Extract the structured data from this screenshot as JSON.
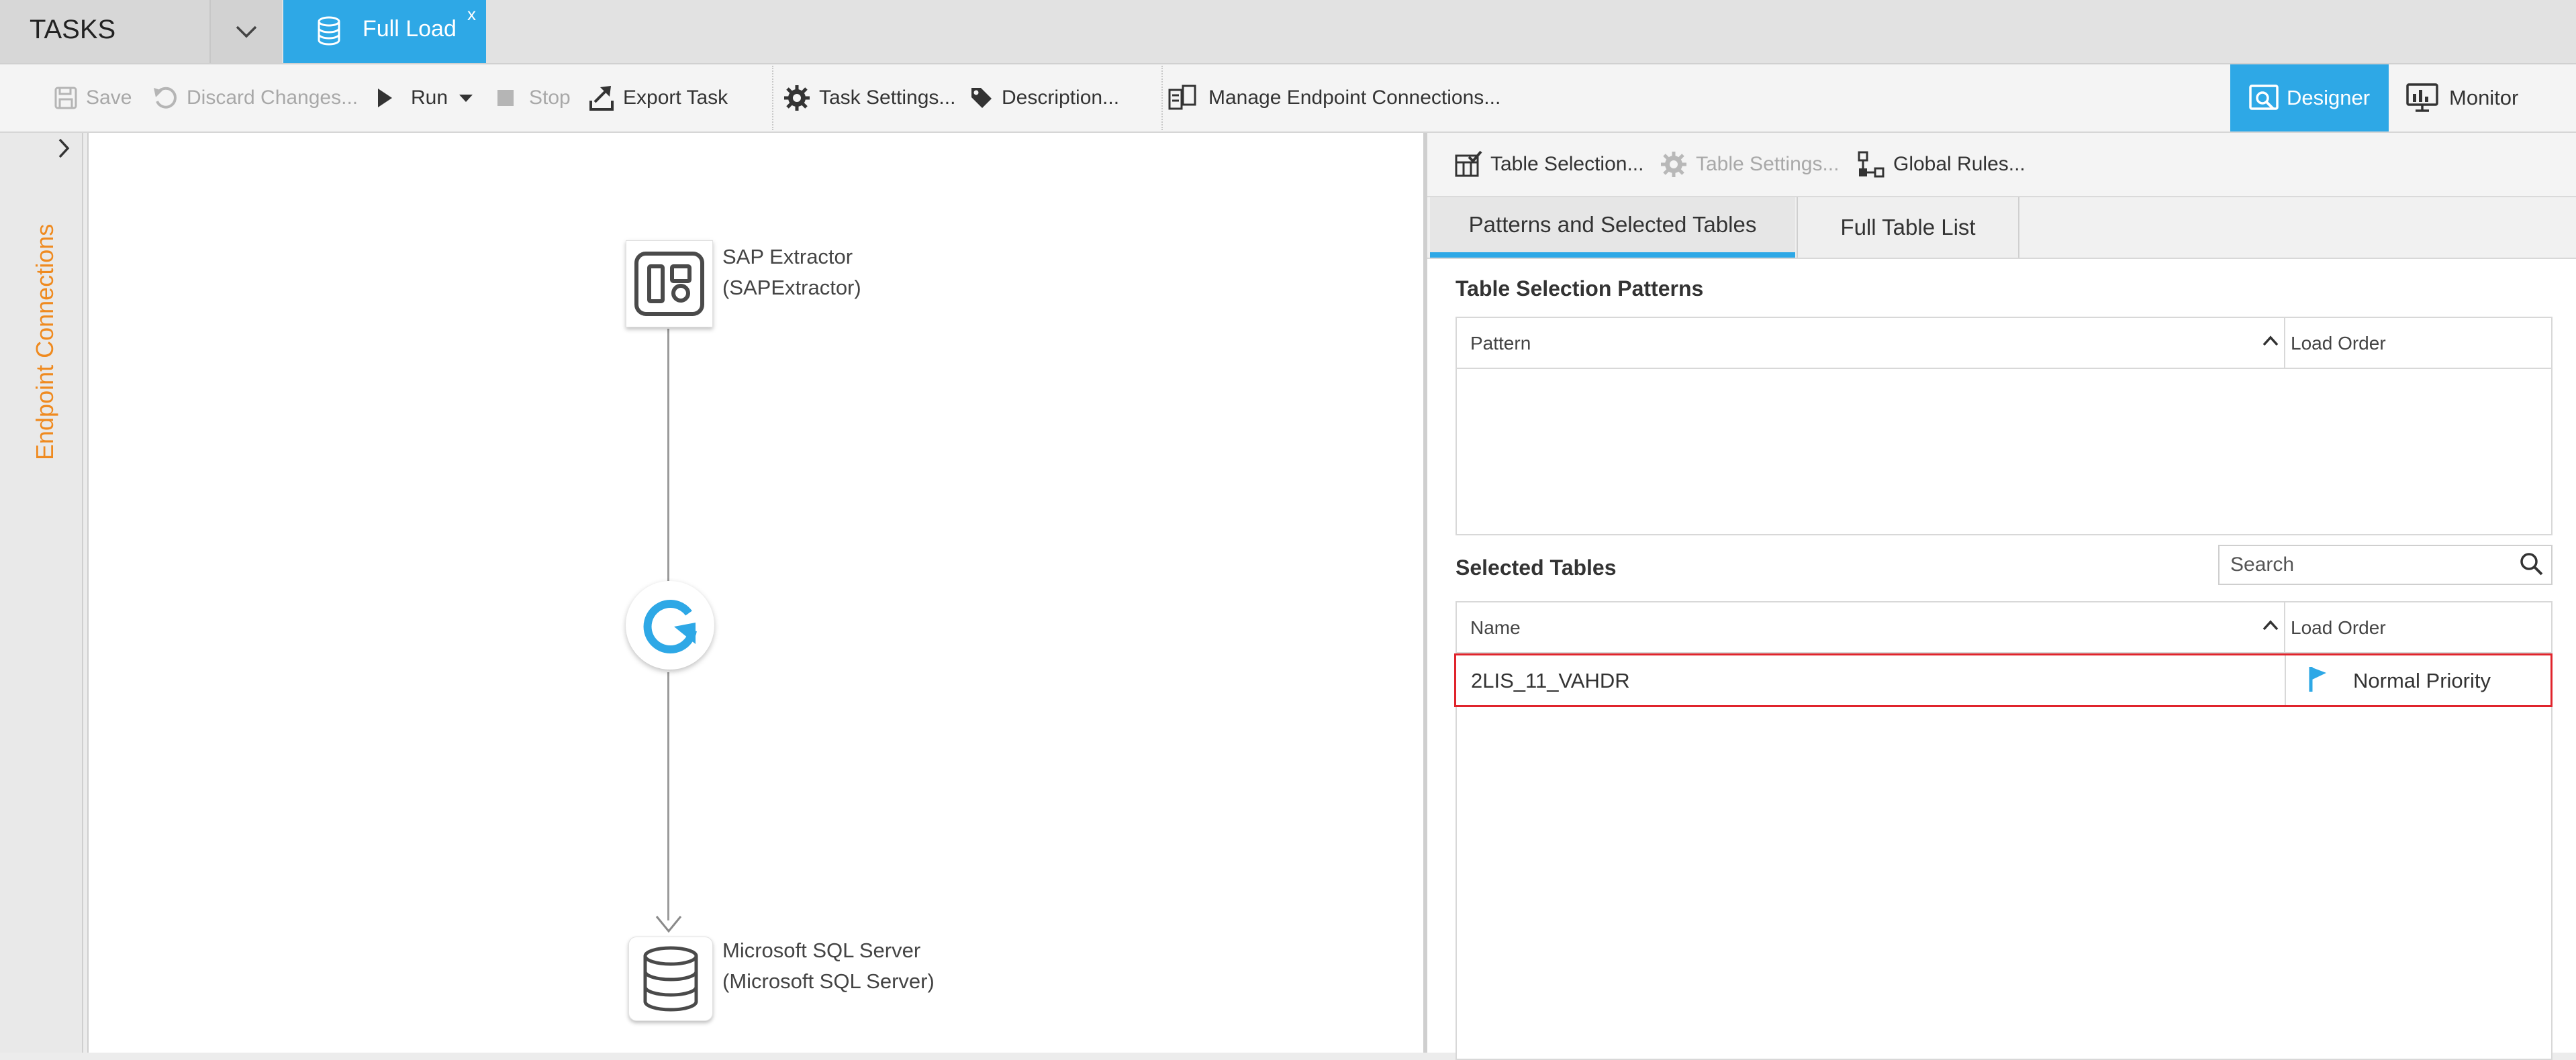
{
  "tabs": {
    "tasks_label": "TASKS",
    "active_tab_label": "Full Load",
    "active_tab_close": "x"
  },
  "toolbar": {
    "save": "Save",
    "discard": "Discard Changes...",
    "run": "Run",
    "stop": "Stop",
    "export": "Export Task",
    "task_settings": "Task Settings...",
    "description": "Description...",
    "manage_endpoints": "Manage Endpoint Connections...",
    "designer": "Designer",
    "monitor": "Monitor"
  },
  "left_rail": {
    "label": "Endpoint Connections"
  },
  "canvas": {
    "source": {
      "name": "SAP Extractor",
      "type": "(SAPExtractor)"
    },
    "target": {
      "name": "Microsoft SQL Server",
      "type": "(Microsoft SQL Server)"
    }
  },
  "right_panel": {
    "toolbar": {
      "table_selection": "Table Selection...",
      "table_settings": "Table Settings...",
      "global_rules": "Global Rules..."
    },
    "tabs": [
      "Patterns and Selected Tables",
      "Full Table List"
    ],
    "patterns": {
      "title": "Table Selection Patterns",
      "columns": [
        "Pattern",
        "Load Order"
      ],
      "rows": []
    },
    "selected": {
      "title": "Selected Tables",
      "search_placeholder": "Search",
      "columns": [
        "Name",
        "Load Order"
      ],
      "rows": [
        {
          "name": "2LIS_11_VAHDR",
          "load_order": "Normal Priority"
        }
      ]
    }
  },
  "colors": {
    "accent": "#2ea8e6",
    "rail_label": "#ef8a1f",
    "highlight_border": "#e0242c"
  }
}
